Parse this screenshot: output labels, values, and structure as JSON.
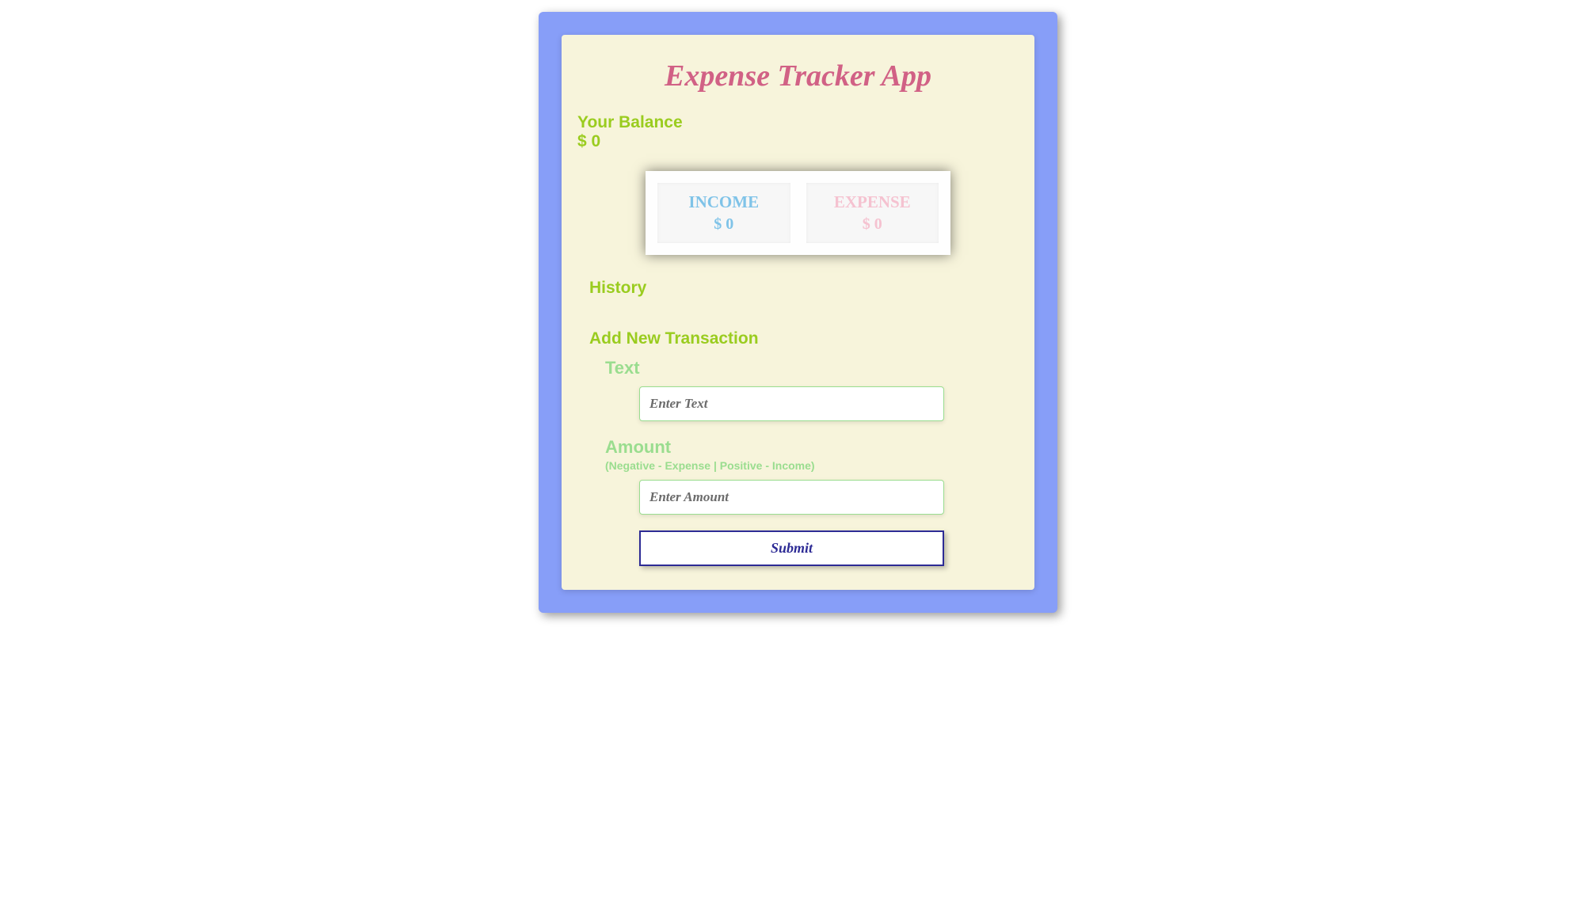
{
  "app": {
    "title": "Expense Tracker App"
  },
  "balance": {
    "label": "Your Balance",
    "amount": "$ 0"
  },
  "income": {
    "label": "INCOME",
    "amount": "$ 0"
  },
  "expense": {
    "label": "EXPENSE",
    "amount": "$ 0"
  },
  "history": {
    "label": "History"
  },
  "form": {
    "title": "Add New Transaction",
    "text": {
      "label": "Text",
      "placeholder": "Enter Text"
    },
    "amount": {
      "label": "Amount",
      "sublabel": "(Negative - Expense | Positive - Income)",
      "placeholder": "Enter Amount"
    },
    "submit": "Submit"
  }
}
